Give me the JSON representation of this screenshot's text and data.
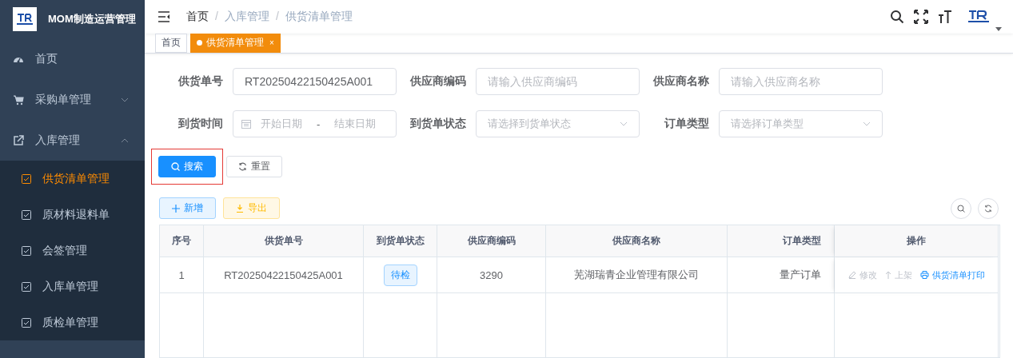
{
  "app": {
    "title": "MOM制造运营管理"
  },
  "sidebar": {
    "items": [
      {
        "label": "首页"
      },
      {
        "label": "采购单管理",
        "expanded": false
      },
      {
        "label": "入库管理",
        "expanded": true,
        "children": [
          {
            "label": "供货清单管理",
            "selected": true
          },
          {
            "label": "原材料退料单",
            "selected": false
          },
          {
            "label": "会签管理",
            "selected": false
          },
          {
            "label": "入库单管理",
            "selected": false
          },
          {
            "label": "质检单管理",
            "selected": false
          }
        ]
      }
    ]
  },
  "breadcrumb": {
    "separator": "/",
    "items": [
      "首页",
      "入库管理",
      "供货清单管理"
    ]
  },
  "tabs": [
    {
      "label": "首页",
      "selected": false
    },
    {
      "label": "供货清单管理",
      "selected": true,
      "close": "×"
    }
  ],
  "filters": [
    {
      "label": "供货单号",
      "kind": "input",
      "value": "RT20250422150425A001"
    },
    {
      "label": "供应商编码",
      "kind": "input",
      "placeholder": "请输入供应商编码"
    },
    {
      "label": "供应商名称",
      "kind": "input",
      "placeholder": "请输入供应商名称"
    },
    {
      "label": "到货时间",
      "kind": "daterange",
      "start_placeholder": "开始日期",
      "separator": "-",
      "end_placeholder": "结束日期"
    },
    {
      "label": "到货单状态",
      "kind": "select",
      "placeholder": "请选择到货单状态"
    },
    {
      "label": "订单类型",
      "kind": "select",
      "placeholder": "请选择订单类型"
    }
  ],
  "search_button": {
    "label": "搜索",
    "highlighted": true
  },
  "reset_button": {
    "label": "重置"
  },
  "toolbar": [
    {
      "label": "新增",
      "kind": "add"
    },
    {
      "label": "导出",
      "kind": "export"
    }
  ],
  "table": {
    "columns": [
      "序号",
      "供货单号",
      "到货单状态",
      "供应商编码",
      "供应商名称",
      "订单类型",
      "操作"
    ],
    "rows": [
      {
        "index": "1",
        "order_no": "RT20250422150425A001",
        "status": "待检",
        "supplier_code": "3290",
        "supplier_name": "芜湖瑞青企业管理有限公司",
        "order_type": "量产订单",
        "actions": [
          {
            "label": "修改",
            "kind": "edit",
            "disabled": true
          },
          {
            "label": "上架",
            "kind": "shelve",
            "disabled": true
          },
          {
            "label": "供货清单打印",
            "kind": "print",
            "disabled": false
          }
        ]
      }
    ]
  }
}
